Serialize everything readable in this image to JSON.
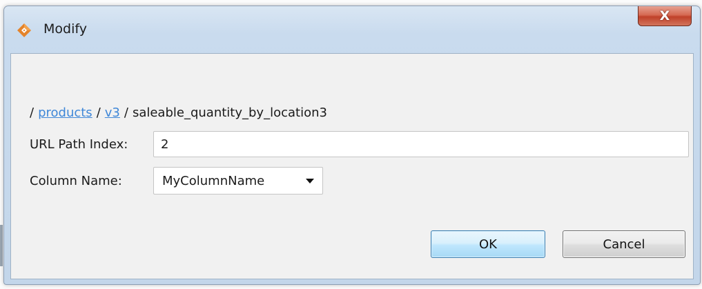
{
  "window": {
    "title": "Modify",
    "close_glyph": "X",
    "app_icon": "orange-diamond-icon"
  },
  "breadcrumb": {
    "separator": "/",
    "items": [
      {
        "label": "products",
        "link": true
      },
      {
        "label": "v3",
        "link": true
      },
      {
        "label": "saleable_quantity_by_location3",
        "link": false
      }
    ]
  },
  "form": {
    "url_path_index": {
      "label": "URL Path Index:",
      "value": "2"
    },
    "column_name": {
      "label": "Column Name:",
      "selected": "MyColumnName"
    }
  },
  "buttons": {
    "ok": "OK",
    "cancel": "Cancel"
  },
  "colors": {
    "link": "#3f87d8",
    "titlebar": "#c9dbee",
    "close_button": "#c0412a",
    "ok_button": "#bee6fd",
    "icon_orange": "#e4832a"
  }
}
